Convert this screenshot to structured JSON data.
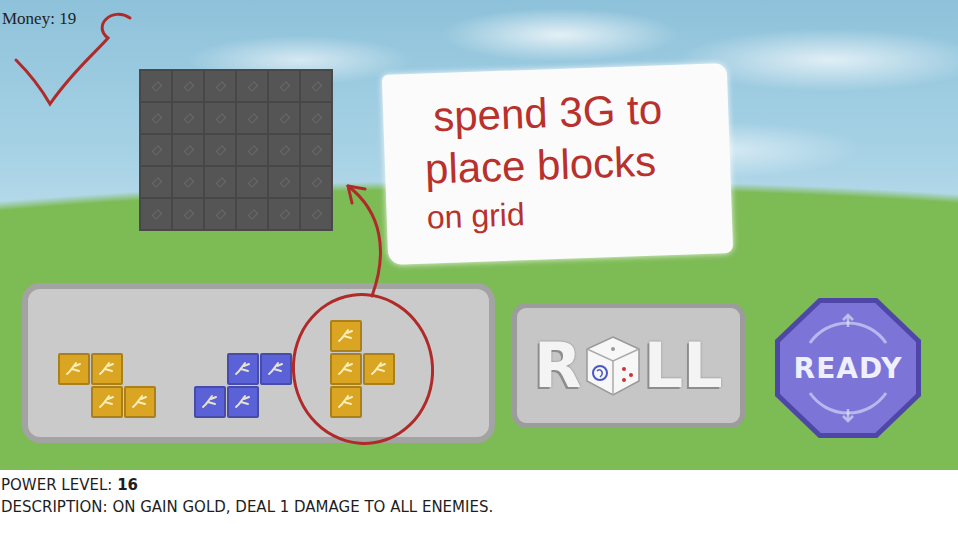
{
  "hud": {
    "money_label": "Money:",
    "money": "19"
  },
  "grid": {
    "rows": [
      [
        {
          "filled": false
        },
        {
          "filled": false
        },
        {
          "filled": false
        },
        {
          "filled": false
        },
        {
          "filled": false
        },
        {
          "filled": false
        }
      ],
      [
        {
          "filled": false
        },
        {
          "filled": false
        },
        {
          "filled": false
        },
        {
          "filled": false
        },
        {
          "filled": false
        },
        {
          "filled": false
        }
      ],
      [
        {
          "filled": false
        },
        {
          "filled": false
        },
        {
          "filled": false
        },
        {
          "filled": false
        },
        {
          "filled": false
        },
        {
          "filled": false
        }
      ],
      [
        {
          "filled": false
        },
        {
          "filled": false
        },
        {
          "filled": false
        },
        {
          "filled": false
        },
        {
          "filled": false
        },
        {
          "filled": false
        }
      ],
      [
        {
          "filled": false
        },
        {
          "filled": false
        },
        {
          "filled": false
        },
        {
          "filled": false
        },
        {
          "filled": false
        },
        {
          "filled": false
        }
      ]
    ]
  },
  "note": {
    "lines": [
      "spend 3G to",
      "place blocks",
      "on grid"
    ]
  },
  "tray": {
    "pieces": [
      {
        "color": "#d9a522",
        "shape": [
          [
            1,
            1,
            0
          ],
          [
            0,
            1,
            1
          ]
        ],
        "selected": false
      },
      {
        "color": "#5b62d8",
        "shape": [
          [
            0,
            1,
            1
          ],
          [
            1,
            1,
            0
          ]
        ],
        "selected": false
      },
      {
        "color": "#d9a522",
        "shape": [
          [
            1,
            0
          ],
          [
            1,
            1
          ],
          [
            1,
            0
          ]
        ],
        "selected": true
      }
    ]
  },
  "roll_button": {
    "label_parts": [
      "R",
      "LL"
    ]
  },
  "ready_button": {
    "label": "READY"
  },
  "info": {
    "power_level": {
      "label": "POWER LEVEL:",
      "value": "16"
    },
    "description": {
      "label": "DESCRIPTION:",
      "value": "ON GAIN GOLD, DEAL 1 DAMAGE TO ALL ENEMIES."
    }
  }
}
